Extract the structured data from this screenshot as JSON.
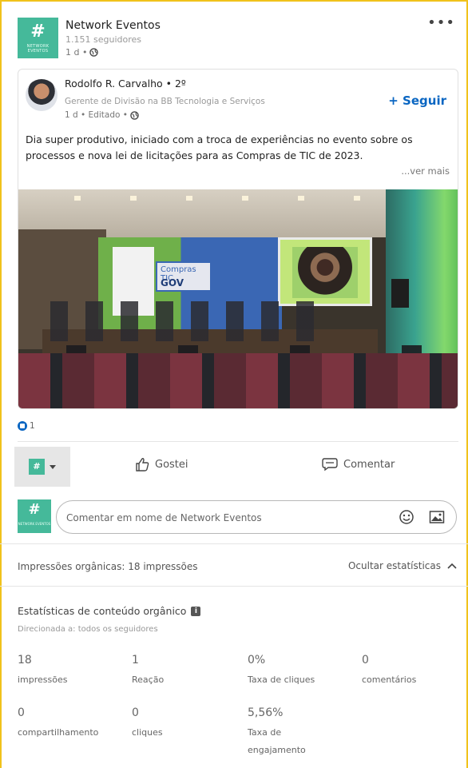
{
  "company": {
    "name": "Network Eventos",
    "followers": "1.151 seguidores",
    "time": "1 d •",
    "logo_hash": "#",
    "logo_sub": "NETWORK EVENTOS",
    "brand_color": "#45b99a"
  },
  "author": {
    "name": "Rodolfo R. Carvalho • 2º",
    "headline": "Gerente de Divisão na BB Tecnologia e Serviços",
    "time": "1 d • Editado •",
    "follow_label": "+ Seguir"
  },
  "post": {
    "text": "Dia super produtivo, iniciado com a troca de experiências no evento sobre os processos e nova lei de licitações para as Compras de TIC de 2023.",
    "see_more": "...ver mais",
    "image_logo_line1": "Compras TIC",
    "image_logo_line2": "GOV",
    "image_icon": "conference-photo"
  },
  "reactions": {
    "count": "1",
    "icon": "like-icon"
  },
  "actions": {
    "like": "Gostei",
    "comment": "Comentar"
  },
  "comment_box": {
    "placeholder": "Comentar em nome de Network Eventos"
  },
  "stats": {
    "organic_impressions": "Impressões orgânicas: 18 impressões",
    "hide": "Ocultar estatísticas",
    "title": "Estatísticas de conteúdo orgânico",
    "subtitle": "Direcionada a: todos os seguidores",
    "metrics": [
      {
        "value": "18",
        "label": "impressões"
      },
      {
        "value": "1",
        "label": "Reação"
      },
      {
        "value": "0%",
        "label": "Taxa de cliques"
      },
      {
        "value": "0",
        "label": "comentários"
      },
      {
        "value": "0",
        "label": "compartilhamento"
      },
      {
        "value": "0",
        "label": "cliques"
      },
      {
        "value": "5,56%",
        "label": "Taxa de engajamento"
      }
    ]
  },
  "accent_color": "#0a66c2",
  "frame_color": "#f1c21b"
}
